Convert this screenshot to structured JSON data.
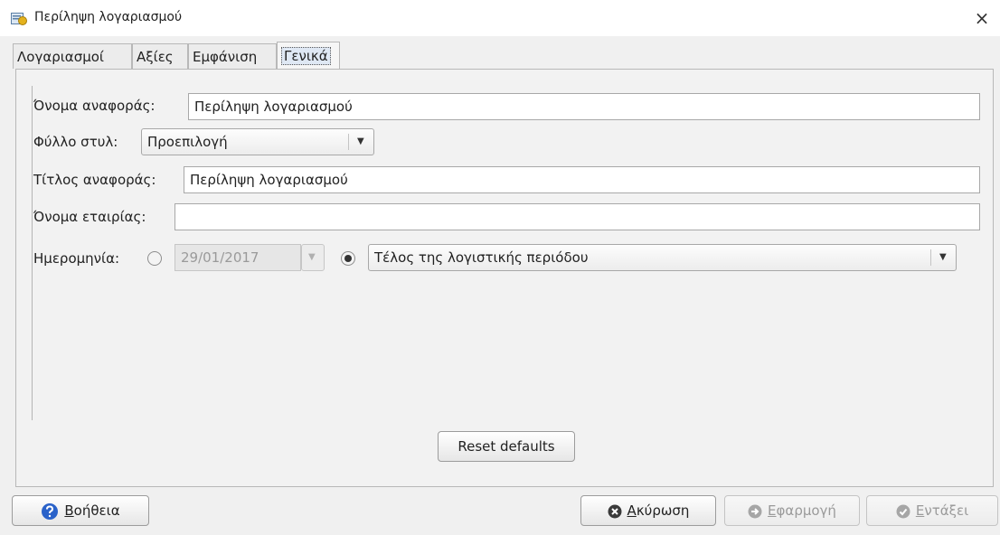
{
  "window": {
    "title": "Περίληψη λογαριασμού",
    "close_glyph": "×"
  },
  "tabs": [
    {
      "label": "Λογαριασμοί",
      "active": false
    },
    {
      "label": "Αξίες",
      "active": false
    },
    {
      "label": "Εμφάνιση",
      "active": false
    },
    {
      "label": "Γενικά",
      "active": true
    }
  ],
  "general": {
    "report_name_label": "Όνομα αναφοράς:",
    "report_name_value": "Περίληψη λογαριασμού",
    "stylesheet_label": "Φύλλο στυλ:",
    "stylesheet_value": "Προεπιλογή",
    "report_title_label": "Τίτλος αναφοράς:",
    "report_title_value": "Περίληψη λογαριασμού",
    "company_name_label": "Όνομα εταιρίας:",
    "company_name_value": "",
    "date_label": "Ημερομηνία:",
    "date_value": "29/01/2017",
    "relative_date_value": "Τέλος της λογιστικής περιόδου",
    "reset_defaults": "Reset defaults"
  },
  "buttons": {
    "help_mnemonic": "Β",
    "help_rest": "οήθεια",
    "cancel_mnemonic": "Α",
    "cancel_rest": "κύρωση",
    "apply_mnemonic": "Ε",
    "apply_rest": "φαρμογή",
    "ok_mnemonic": "Ε",
    "ok_rest": "ντάξει"
  },
  "icons": {
    "app": "report-icon",
    "help": "help-icon",
    "cancel": "cancel-icon",
    "apply": "apply-icon",
    "ok": "ok-icon",
    "dropdown": "chevron-down-icon"
  },
  "colors": {
    "help_icon": "#2a62c9",
    "cancel_icon": "#3a3a3a",
    "disabled_icon": "#a6a6a6"
  }
}
